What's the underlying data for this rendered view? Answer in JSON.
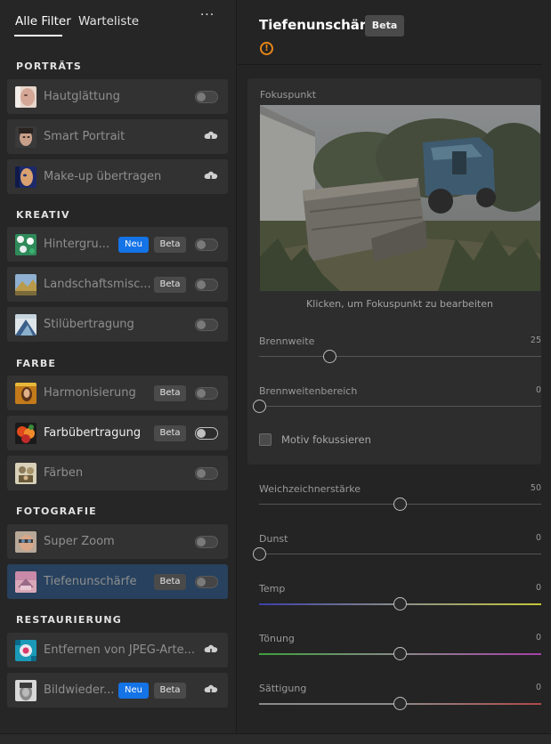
{
  "tabs": {
    "all_filters": "Alle Filter",
    "waitlist": "Warteliste",
    "more": "···"
  },
  "badges": {
    "new": "Neu",
    "beta": "Beta"
  },
  "sections": [
    {
      "title": "PORTRÄTS",
      "items": [
        {
          "label": "Hautglättung",
          "control": "toggle"
        },
        {
          "label": "Smart Portrait",
          "control": "cloud-download"
        },
        {
          "label": "Make-up übertragen",
          "control": "cloud-download"
        }
      ]
    },
    {
      "title": "KREATIV",
      "items": [
        {
          "label": "Hintergru...",
          "badges": [
            "Neu",
            "Beta"
          ],
          "control": "toggle"
        },
        {
          "label": "Landschaftsmisc...",
          "badges": [
            "Beta"
          ],
          "control": "toggle"
        },
        {
          "label": "Stilübertragung",
          "control": "toggle"
        }
      ]
    },
    {
      "title": "FARBE",
      "items": [
        {
          "label": "Harmonisierung",
          "badges": [
            "Beta"
          ],
          "control": "toggle"
        },
        {
          "label": "Farbübertragung",
          "badges": [
            "Beta"
          ],
          "control": "toggle",
          "highlighted": true
        },
        {
          "label": "Färben",
          "control": "toggle"
        }
      ]
    },
    {
      "title": "FOTOGRAFIE",
      "items": [
        {
          "label": "Super Zoom",
          "control": "toggle"
        },
        {
          "label": "Tiefenunschärfe",
          "badges": [
            "Beta"
          ],
          "control": "toggle",
          "selected": true
        }
      ]
    },
    {
      "title": "RESTAURIERUNG",
      "items": [
        {
          "label": "Entfernen von JPEG-Arte...",
          "control": "cloud-download"
        },
        {
          "label": "Bildwieder...",
          "badges": [
            "Neu",
            "Beta"
          ],
          "control": "cloud-download"
        }
      ]
    }
  ],
  "panel": {
    "title": "Tiefenunschärfe",
    "badge": "Beta",
    "warning": "!",
    "focus_point_label": "Fokuspunkt",
    "focus_caption": "Klicken, um Fokuspunkt zu bearbeiten",
    "focus_subject_label": "Motiv fokussieren",
    "focus_subject_checked": false,
    "sliders": {
      "focal_distance": {
        "label": "Brennweite",
        "value": 25,
        "min": 0,
        "max": 100
      },
      "focal_range": {
        "label": "Brennweitenbereich",
        "value": 0,
        "min": 0,
        "max": 100
      },
      "blur_strength": {
        "label": "Weichzeichnerstärke",
        "value": 50,
        "min": 0,
        "max": 100
      },
      "haze": {
        "label": "Dunst",
        "value": 0,
        "min": 0,
        "max": 100
      },
      "temp": {
        "label": "Temp",
        "value": 0,
        "min": -50,
        "max": 50
      },
      "tint": {
        "label": "Tönung",
        "value": 0,
        "min": -50,
        "max": 50
      },
      "saturation": {
        "label": "Sättigung",
        "value": 0,
        "min": -50,
        "max": 50
      }
    }
  },
  "colors": {
    "accent_blue": "#1473e6",
    "selected_row": "#27415e",
    "warning": "#e68619"
  }
}
